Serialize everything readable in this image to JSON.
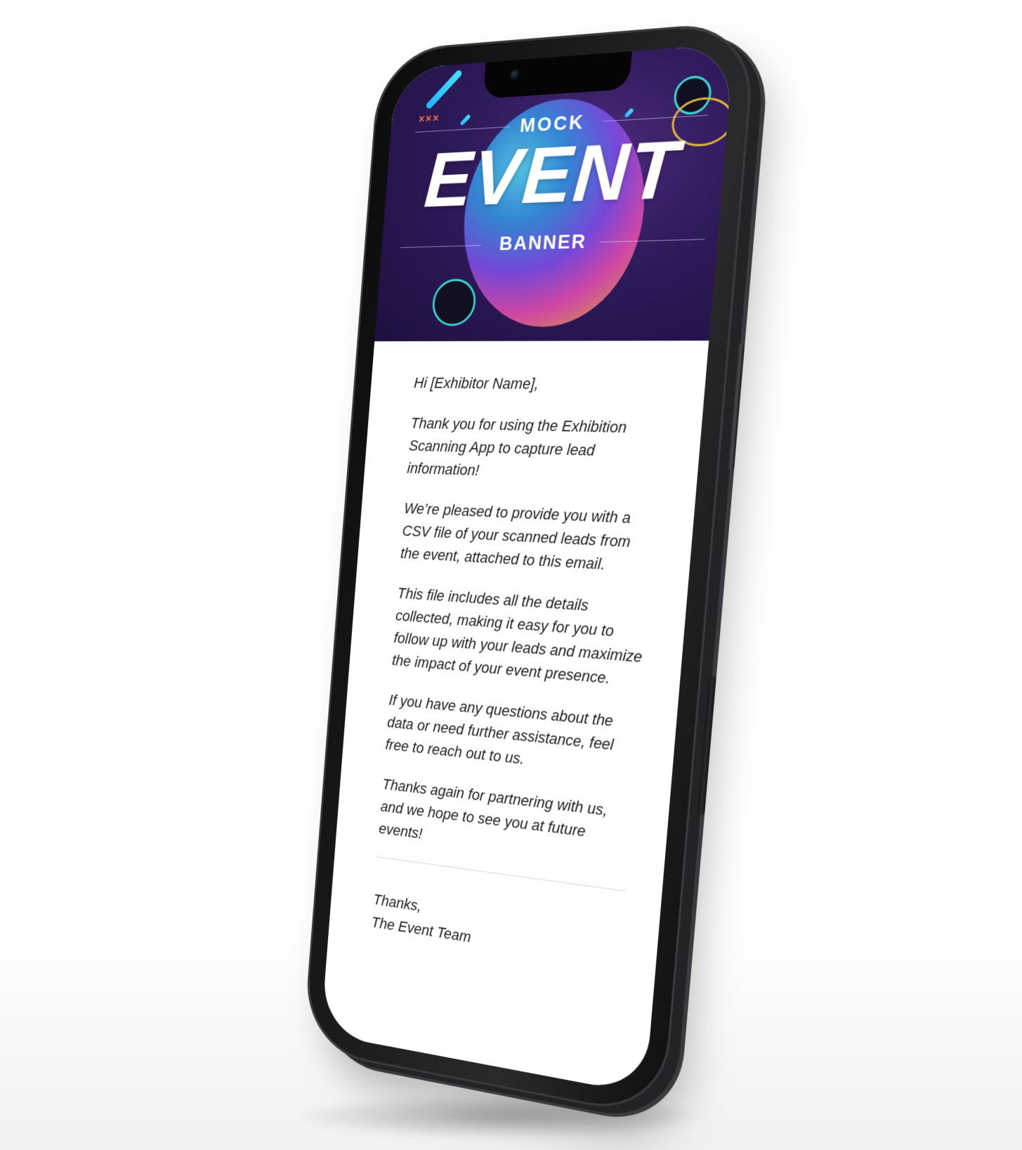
{
  "banner": {
    "line_top": "MOCK",
    "line_main": "EVENT",
    "line_bottom": "BANNER",
    "decor_marks": "×××"
  },
  "email": {
    "greeting": "Hi [Exhibitor Name],",
    "paragraphs": [
      "Thank you for using the Exhibition Scanning App to capture lead information!",
      "We’re pleased to provide you with a CSV file of your scanned leads from the event, attached to this email.",
      "This file includes all the details collected, making it easy for you to follow up with your leads and maximize the impact of your event presence.",
      "If you have any questions about the data or need further assistance, feel free to reach out to us.",
      "Thanks again for partnering with us, and we hope to see you at future events!"
    ],
    "signoff_line1": "Thanks,",
    "signoff_line2": "The Event Team"
  },
  "colors": {
    "banner_bg": "#2f1a5a",
    "accent_cyan": "#3ad7d6",
    "phone_body": "#1c1c1e"
  }
}
